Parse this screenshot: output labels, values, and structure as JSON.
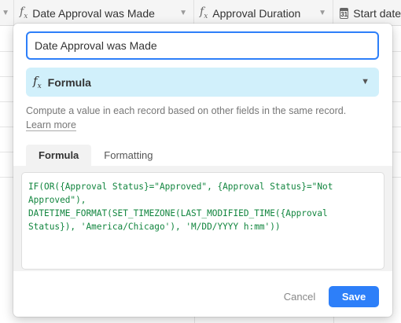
{
  "header": {
    "columns": [
      {
        "label": "",
        "icon": "chevron-down-icon"
      },
      {
        "label": "Date Approval was Made",
        "icon": "formula-icon"
      },
      {
        "label": "Approval Duration",
        "icon": "formula-icon"
      },
      {
        "label": "Start date",
        "icon": "calendar-icon",
        "icon_text": "31"
      }
    ]
  },
  "field_editor": {
    "name_value": "Date Approval was Made",
    "type_label": "Formula",
    "type_icon": "formula-icon",
    "description": "Compute a value in each record based on other fields in the same record.",
    "learn_more": "Learn more",
    "tabs": [
      {
        "label": "Formula",
        "active": true
      },
      {
        "label": "Formatting",
        "active": false
      }
    ],
    "formula": "IF(OR({Approval Status}=\"Approved\", {Approval Status}=\"Not Approved\"),\nDATETIME_FORMAT(SET_TIMEZONE(LAST_MODIFIED_TIME({Approval Status}), 'America/Chicago'), 'M/DD/YYYY h:mm'))",
    "cancel_label": "Cancel",
    "save_label": "Save"
  },
  "colors": {
    "accent": "#2d7ff9",
    "type_select_bg": "#d1f0fb",
    "formula_text": "#11853e"
  }
}
